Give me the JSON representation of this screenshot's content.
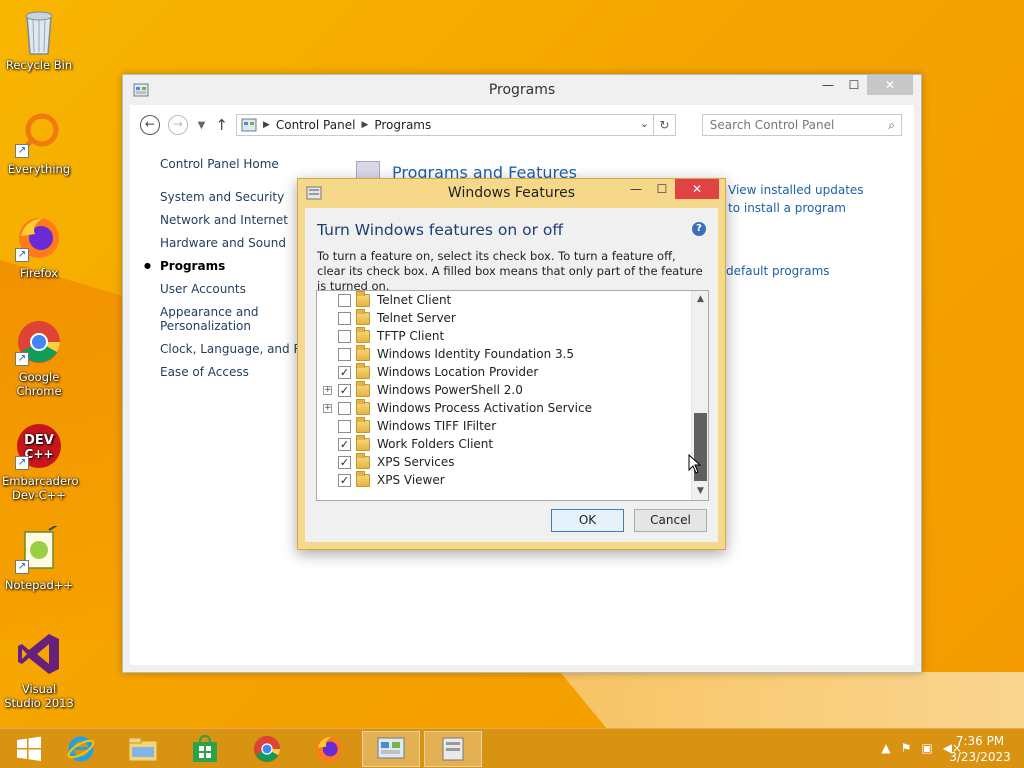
{
  "desktop": {
    "icons": [
      {
        "label": "Recycle Bin",
        "icon": "recycle-bin-icon"
      },
      {
        "label": "Everything",
        "icon": "everything-search-icon"
      },
      {
        "label": "Firefox",
        "icon": "firefox-icon"
      },
      {
        "label": "Google Chrome",
        "icon": "chrome-icon"
      },
      {
        "label": "Embarcadero Dev-C++",
        "icon": "devcpp-icon"
      },
      {
        "label": "Notepad++",
        "icon": "notepadpp-icon"
      },
      {
        "label": "Visual Studio 2013",
        "icon": "visual-studio-icon"
      }
    ]
  },
  "cp_window": {
    "title": "Programs",
    "minimize": "—",
    "maximize": "☐",
    "close": "✕",
    "address": {
      "crumbs": [
        "Control Panel",
        "Programs"
      ]
    },
    "search_placeholder": "Search Control Panel",
    "nav": {
      "home": "Control Panel Home",
      "items": [
        "System and Security",
        "Network and Internet",
        "Hardware and Sound",
        "Programs",
        "User Accounts",
        "Appearance and Personalization",
        "Clock, Language, and Reg",
        "Ease of Access"
      ],
      "active_index": 3
    },
    "section_heading": "Programs and Features",
    "links": {
      "view_updates": "View installed updates",
      "install_program": "to install a program",
      "default_programs": "default programs"
    }
  },
  "dialog": {
    "title": "Windows Features",
    "minimize": "—",
    "maximize": "☐",
    "close": "✕",
    "heading": "Turn Windows features on or off",
    "help": "?",
    "description": "To turn a feature on, select its check box. To turn a feature off, clear its check box. A filled box means that only part of the feature is turned on.",
    "features": [
      {
        "label": "Telnet Client",
        "checked": false,
        "expandable": false
      },
      {
        "label": "Telnet Server",
        "checked": false,
        "expandable": false
      },
      {
        "label": "TFTP Client",
        "checked": false,
        "expandable": false
      },
      {
        "label": "Windows Identity Foundation 3.5",
        "checked": false,
        "expandable": false
      },
      {
        "label": "Windows Location Provider",
        "checked": true,
        "expandable": false
      },
      {
        "label": "Windows PowerShell 2.0",
        "checked": true,
        "expandable": true
      },
      {
        "label": "Windows Process Activation Service",
        "checked": false,
        "expandable": true
      },
      {
        "label": "Windows TIFF IFilter",
        "checked": false,
        "expandable": false
      },
      {
        "label": "Work Folders Client",
        "checked": true,
        "expandable": false
      },
      {
        "label": "XPS Services",
        "checked": true,
        "expandable": false
      },
      {
        "label": "XPS Viewer",
        "checked": true,
        "expandable": false
      }
    ],
    "ok": "OK",
    "cancel": "Cancel"
  },
  "taskbar": {
    "items": [
      "start-icon",
      "internet-explorer-icon",
      "file-explorer-icon",
      "store-icon",
      "chrome-icon",
      "firefox-icon",
      "control-panel-icon",
      "windows-features-icon"
    ],
    "time": "7:36 PM",
    "date": "3/23/2023"
  },
  "colors": {
    "wallpaper": "#f5a400",
    "link": "#1e5fa8",
    "dialog_frame": "#f6d88b",
    "close_red": "#e04343"
  }
}
